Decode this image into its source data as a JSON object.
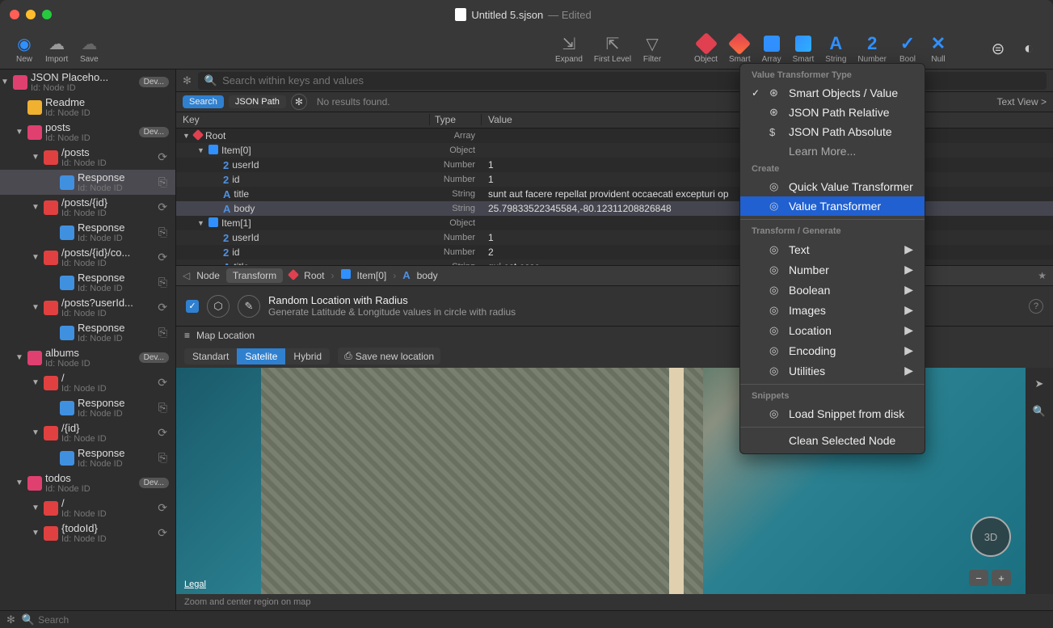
{
  "window": {
    "title": "Untitled 5.sjson",
    "edited": "— Edited"
  },
  "toolbar": {
    "new": "New",
    "import": "Import",
    "save": "Save",
    "expand": "Expand",
    "first_level": "First Level",
    "filter": "Filter",
    "types": {
      "object": "Object",
      "smart": "Smart",
      "array": "Array",
      "smart2": "Smart",
      "string": "String",
      "number": "Number",
      "bool": "Bool",
      "null": "Null"
    }
  },
  "sidebar": {
    "id_label": "Id:",
    "node_id": "Node ID",
    "dev_badge": "Dev...",
    "items": [
      {
        "name": "JSON Placeho...",
        "kind": "root",
        "badge": true,
        "indent": 0
      },
      {
        "name": "Readme",
        "kind": "doc",
        "indent": 1
      },
      {
        "name": "posts",
        "kind": "folder",
        "badge": true,
        "indent": 1
      },
      {
        "name": "/posts",
        "kind": "endpoint",
        "refresh": true,
        "indent": 2
      },
      {
        "name": "Response",
        "kind": "response",
        "link": true,
        "selected": true,
        "indent": 3
      },
      {
        "name": "/posts/{id}",
        "kind": "endpoint",
        "refresh": true,
        "indent": 2
      },
      {
        "name": "Response",
        "kind": "response",
        "link": true,
        "indent": 3
      },
      {
        "name": "/posts/{id}/co...",
        "kind": "endpoint",
        "refresh": true,
        "indent": 2
      },
      {
        "name": "Response",
        "kind": "response",
        "link": true,
        "indent": 3
      },
      {
        "name": "/posts?userId...",
        "kind": "endpoint",
        "refresh": true,
        "indent": 2
      },
      {
        "name": "Response",
        "kind": "response",
        "link": true,
        "indent": 3
      },
      {
        "name": "albums",
        "kind": "folder",
        "badge": true,
        "indent": 1
      },
      {
        "name": "/",
        "kind": "endpoint",
        "refresh": true,
        "indent": 2
      },
      {
        "name": "Response",
        "kind": "response",
        "link": true,
        "indent": 3
      },
      {
        "name": "/{id}",
        "kind": "endpoint",
        "refresh": true,
        "indent": 2
      },
      {
        "name": "Response",
        "kind": "response",
        "link": true,
        "indent": 3
      },
      {
        "name": "todos",
        "kind": "folder",
        "badge": true,
        "indent": 1
      },
      {
        "name": "/",
        "kind": "endpoint",
        "refresh": true,
        "indent": 2
      },
      {
        "name": "{todoId}",
        "kind": "endpoint",
        "refresh": true,
        "indent": 2
      }
    ]
  },
  "search": {
    "placeholder": "Search within keys and values",
    "search_chip": "Search",
    "jsonpath_chip": "JSON Path",
    "no_results": "No results found.",
    "text_view": "Text View >"
  },
  "table": {
    "headers": {
      "key": "Key",
      "type": "Type",
      "value": "Value"
    },
    "rows": [
      {
        "key": "Root",
        "type": "Array",
        "value": "",
        "depth": 0,
        "icon": "obj",
        "disclosure": "▼"
      },
      {
        "key": "Item[0]",
        "type": "Object",
        "value": "",
        "depth": 1,
        "icon": "arr",
        "disclosure": "▼"
      },
      {
        "key": "userId",
        "type": "Number",
        "value": "1",
        "depth": 2,
        "icon": "num"
      },
      {
        "key": "id",
        "type": "Number",
        "value": "1",
        "depth": 2,
        "icon": "num"
      },
      {
        "key": "title",
        "type": "String",
        "value": "sunt aut facere repellat provident occaecati excepturi op",
        "depth": 2,
        "icon": "str"
      },
      {
        "key": "body",
        "type": "String",
        "value": "25.79833522345584,-80.12311208826848",
        "depth": 2,
        "icon": "str",
        "selected": true
      },
      {
        "key": "Item[1]",
        "type": "Object",
        "value": "",
        "depth": 1,
        "icon": "arr",
        "disclosure": "▼"
      },
      {
        "key": "userId",
        "type": "Number",
        "value": "1",
        "depth": 2,
        "icon": "num"
      },
      {
        "key": "id",
        "type": "Number",
        "value": "2",
        "depth": 2,
        "icon": "num"
      },
      {
        "key": "title",
        "type": "String",
        "value": "qui est esse",
        "depth": 2,
        "icon": "str"
      }
    ]
  },
  "breadcrumb": {
    "node": "Node",
    "transform": "Transform",
    "root": "Root",
    "item0": "Item[0]",
    "body": "body"
  },
  "transform": {
    "title": "Random Location with Radius",
    "desc": "Generate Latitude & Longitude values in circle with radius"
  },
  "map": {
    "section_label": "Map Location",
    "tabs": {
      "standard": "Standart",
      "satellite": "Satelite",
      "hybrid": "Hybrid"
    },
    "save": "Save new location",
    "legal": "Legal",
    "compass": "3D",
    "hint": "Zoom and center region on map"
  },
  "dropdown": {
    "header_type": "Value Transformer Type",
    "smart_objects": "Smart Objects / Value",
    "json_rel": "JSON Path Relative",
    "json_abs": "JSON Path Absolute",
    "learn_more": "Learn More...",
    "header_create": "Create",
    "quick_vt": "Quick Value Transformer",
    "vt": "Value Transformer",
    "header_tg": "Transform / Generate",
    "text": "Text",
    "number": "Number",
    "boolean": "Boolean",
    "images": "Images",
    "location": "Location",
    "encoding": "Encoding",
    "utilities": "Utilities",
    "header_snippets": "Snippets",
    "load_snippet": "Load Snippet from disk",
    "clean": "Clean Selected Node"
  },
  "footer": {
    "search_placeholder": "Search"
  }
}
